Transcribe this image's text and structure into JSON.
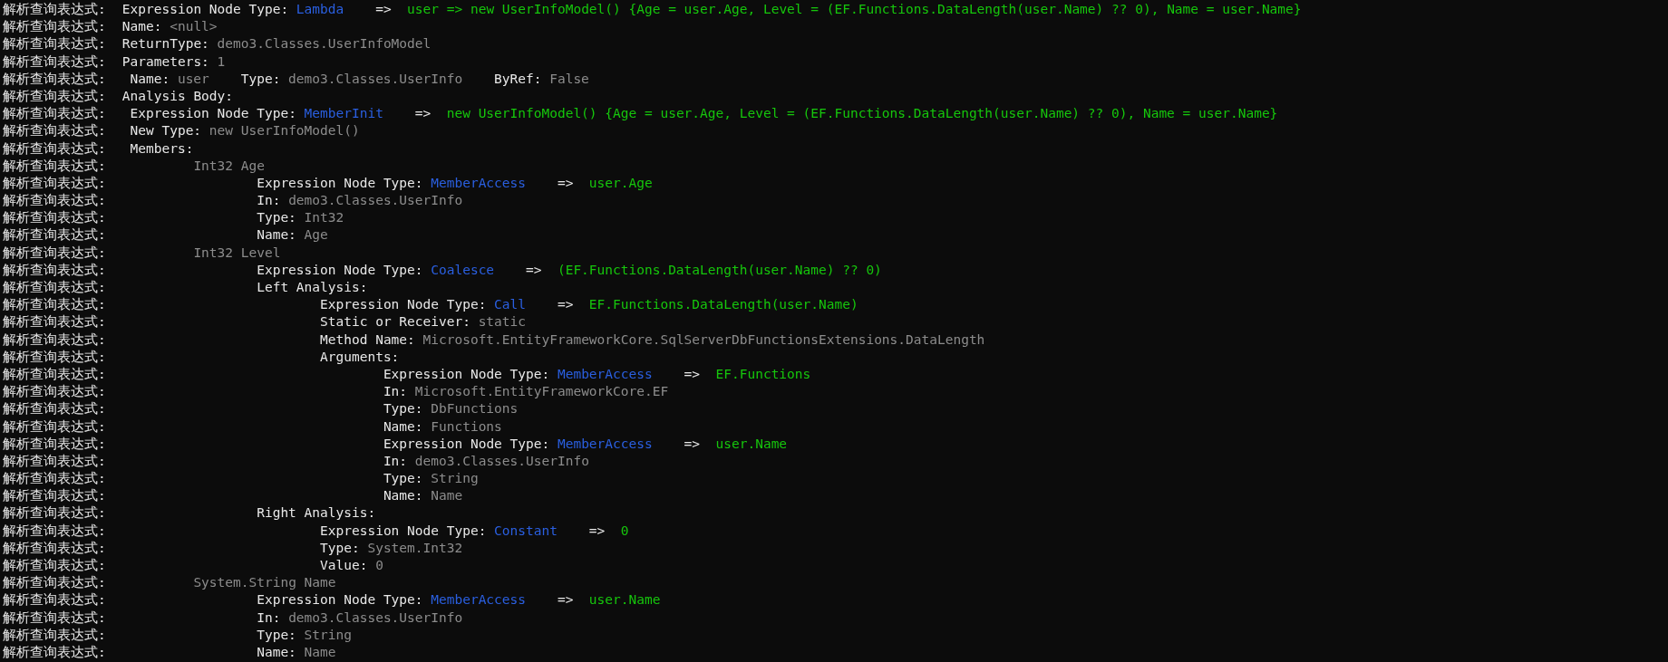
{
  "console": {
    "lines": [
      {
        "prefix": "解析查询表达式:",
        "parts": [
          {
            "kind": "label",
            "text": "Expression Node Type:"
          },
          {
            "kind": "node",
            "text": "Lambda"
          },
          {
            "kind": "arrow",
            "text": "=>"
          },
          {
            "kind": "expr",
            "text": "user => new UserInfoModel() {Age = user.Age, Level = (EF.Functions.DataLength(user.Name) ?? 0), Name = user.Name}"
          }
        ]
      },
      {
        "prefix": "解析查询表达式:",
        "parts": [
          {
            "kind": "label",
            "text": "Name:"
          },
          {
            "kind": "value",
            "text": "<null>"
          }
        ]
      },
      {
        "prefix": "解析查询表达式:",
        "parts": [
          {
            "kind": "label",
            "text": "ReturnType:"
          },
          {
            "kind": "value",
            "text": "demo3.Classes.UserInfoModel"
          }
        ]
      },
      {
        "prefix": "解析查询表达式:",
        "parts": [
          {
            "kind": "label",
            "text": "Parameters:"
          },
          {
            "kind": "value",
            "text": "1"
          }
        ],
        "children": [
          {
            "prefix": "解析查询表达式:",
            "parts": [
              {
                "kind": "label",
                "text": "Name:"
              },
              {
                "kind": "value",
                "text": "user"
              },
              {
                "kind": "label",
                "text": "Type:"
              },
              {
                "kind": "value",
                "text": "demo3.Classes.UserInfo"
              },
              {
                "kind": "label",
                "text": "ByRef:"
              },
              {
                "kind": "value",
                "text": "False"
              }
            ]
          }
        ]
      },
      {
        "prefix": "解析查询表达式:",
        "parts": [
          {
            "kind": "label",
            "text": "Analysis Body:"
          }
        ],
        "children": [
          {
            "prefix": "解析查询表达式:",
            "parts": [
              {
                "kind": "label",
                "text": "Expression Node Type:"
              },
              {
                "kind": "node",
                "text": "MemberInit"
              },
              {
                "kind": "arrow",
                "text": "=>"
              },
              {
                "kind": "expr",
                "text": "new UserInfoModel() {Age = user.Age, Level = (EF.Functions.DataLength(user.Name) ?? 0), Name = user.Name}"
              }
            ]
          },
          {
            "prefix": "解析查询表达式:",
            "parts": [
              {
                "kind": "label",
                "text": "New Type:"
              },
              {
                "kind": "value",
                "text": "new UserInfoModel()"
              }
            ]
          },
          {
            "prefix": "解析查询表达式:",
            "parts": [
              {
                "kind": "label",
                "text": "Members:"
              }
            ],
            "children": [
              {
                "prefix": "解析查询表达式:",
                "parts": [
                  {
                    "kind": "value",
                    "text": "Int32 Age"
                  }
                ],
                "children": [
                  {
                    "prefix": "解析查询表达式:",
                    "parts": [
                      {
                        "kind": "label",
                        "text": "Expression Node Type:"
                      },
                      {
                        "kind": "node",
                        "text": "MemberAccess"
                      },
                      {
                        "kind": "arrow",
                        "text": "=>"
                      },
                      {
                        "kind": "expr",
                        "text": "user.Age"
                      }
                    ]
                  },
                  {
                    "prefix": "解析查询表达式:",
                    "parts": [
                      {
                        "kind": "label",
                        "text": "In:"
                      },
                      {
                        "kind": "value",
                        "text": "demo3.Classes.UserInfo"
                      }
                    ]
                  },
                  {
                    "prefix": "解析查询表达式:",
                    "parts": [
                      {
                        "kind": "label",
                        "text": "Type:"
                      },
                      {
                        "kind": "value",
                        "text": "Int32"
                      }
                    ]
                  },
                  {
                    "prefix": "解析查询表达式:",
                    "parts": [
                      {
                        "kind": "label",
                        "text": "Name:"
                      },
                      {
                        "kind": "value",
                        "text": "Age"
                      }
                    ]
                  }
                ]
              },
              {
                "prefix": "解析查询表达式:",
                "parts": [
                  {
                    "kind": "value",
                    "text": "Int32 Level"
                  }
                ],
                "children": [
                  {
                    "prefix": "解析查询表达式:",
                    "parts": [
                      {
                        "kind": "label",
                        "text": "Expression Node Type:"
                      },
                      {
                        "kind": "node",
                        "text": "Coalesce"
                      },
                      {
                        "kind": "arrow",
                        "text": "=>"
                      },
                      {
                        "kind": "expr",
                        "text": "(EF.Functions.DataLength(user.Name) ?? 0)"
                      }
                    ]
                  },
                  {
                    "prefix": "解析查询表达式:",
                    "parts": [
                      {
                        "kind": "label",
                        "text": "Left Analysis:"
                      }
                    ],
                    "children": [
                      {
                        "prefix": "解析查询表达式:",
                        "parts": [
                          {
                            "kind": "label",
                            "text": "Expression Node Type:"
                          },
                          {
                            "kind": "node",
                            "text": "Call"
                          },
                          {
                            "kind": "arrow",
                            "text": "=>"
                          },
                          {
                            "kind": "expr",
                            "text": "EF.Functions.DataLength(user.Name)"
                          }
                        ]
                      },
                      {
                        "prefix": "解析查询表达式:",
                        "parts": [
                          {
                            "kind": "label",
                            "text": "Static or Receiver:"
                          },
                          {
                            "kind": "value",
                            "text": "static"
                          }
                        ]
                      },
                      {
                        "prefix": "解析查询表达式:",
                        "parts": [
                          {
                            "kind": "label",
                            "text": "Method Name:"
                          },
                          {
                            "kind": "value",
                            "text": "Microsoft.EntityFrameworkCore.SqlServerDbFunctionsExtensions.DataLength"
                          }
                        ]
                      },
                      {
                        "prefix": "解析查询表达式:",
                        "parts": [
                          {
                            "kind": "label",
                            "text": "Arguments:"
                          }
                        ],
                        "children": [
                          {
                            "prefix": "解析查询表达式:",
                            "parts": [
                              {
                                "kind": "label",
                                "text": "Expression Node Type:"
                              },
                              {
                                "kind": "node",
                                "text": "MemberAccess"
                              },
                              {
                                "kind": "arrow",
                                "text": "=>"
                              },
                              {
                                "kind": "expr",
                                "text": "EF.Functions"
                              }
                            ]
                          },
                          {
                            "prefix": "解析查询表达式:",
                            "parts": [
                              {
                                "kind": "label",
                                "text": "In:"
                              },
                              {
                                "kind": "value",
                                "text": "Microsoft.EntityFrameworkCore.EF"
                              }
                            ]
                          },
                          {
                            "prefix": "解析查询表达式:",
                            "parts": [
                              {
                                "kind": "label",
                                "text": "Type:"
                              },
                              {
                                "kind": "value",
                                "text": "DbFunctions"
                              }
                            ]
                          },
                          {
                            "prefix": "解析查询表达式:",
                            "parts": [
                              {
                                "kind": "label",
                                "text": "Name:"
                              },
                              {
                                "kind": "value",
                                "text": "Functions"
                              }
                            ]
                          },
                          {
                            "prefix": "解析查询表达式:",
                            "parts": [
                              {
                                "kind": "label",
                                "text": "Expression Node Type:"
                              },
                              {
                                "kind": "node",
                                "text": "MemberAccess"
                              },
                              {
                                "kind": "arrow",
                                "text": "=>"
                              },
                              {
                                "kind": "expr",
                                "text": "user.Name"
                              }
                            ]
                          },
                          {
                            "prefix": "解析查询表达式:",
                            "parts": [
                              {
                                "kind": "label",
                                "text": "In:"
                              },
                              {
                                "kind": "value",
                                "text": "demo3.Classes.UserInfo"
                              }
                            ]
                          },
                          {
                            "prefix": "解析查询表达式:",
                            "parts": [
                              {
                                "kind": "label",
                                "text": "Type:"
                              },
                              {
                                "kind": "value",
                                "text": "String"
                              }
                            ]
                          },
                          {
                            "prefix": "解析查询表达式:",
                            "parts": [
                              {
                                "kind": "label",
                                "text": "Name:"
                              },
                              {
                                "kind": "value",
                                "text": "Name"
                              }
                            ]
                          }
                        ]
                      }
                    ]
                  },
                  {
                    "prefix": "解析查询表达式:",
                    "parts": [
                      {
                        "kind": "label",
                        "text": "Right Analysis:"
                      }
                    ],
                    "children": [
                      {
                        "prefix": "解析查询表达式:",
                        "parts": [
                          {
                            "kind": "label",
                            "text": "Expression Node Type:"
                          },
                          {
                            "kind": "node",
                            "text": "Constant"
                          },
                          {
                            "kind": "arrow",
                            "text": "=>"
                          },
                          {
                            "kind": "expr",
                            "text": "0"
                          }
                        ]
                      },
                      {
                        "prefix": "解析查询表达式:",
                        "parts": [
                          {
                            "kind": "label",
                            "text": "Type:"
                          },
                          {
                            "kind": "value",
                            "text": "System.Int32"
                          }
                        ]
                      },
                      {
                        "prefix": "解析查询表达式:",
                        "parts": [
                          {
                            "kind": "label",
                            "text": "Value:"
                          },
                          {
                            "kind": "value",
                            "text": "0"
                          }
                        ]
                      }
                    ]
                  }
                ]
              },
              {
                "prefix": "解析查询表达式:",
                "parts": [
                  {
                    "kind": "value",
                    "text": "System.String Name"
                  }
                ],
                "children": [
                  {
                    "prefix": "解析查询表达式:",
                    "parts": [
                      {
                        "kind": "label",
                        "text": "Expression Node Type:"
                      },
                      {
                        "kind": "node",
                        "text": "MemberAccess"
                      },
                      {
                        "kind": "arrow",
                        "text": "=>"
                      },
                      {
                        "kind": "expr",
                        "text": "user.Name"
                      }
                    ]
                  },
                  {
                    "prefix": "解析查询表达式:",
                    "parts": [
                      {
                        "kind": "label",
                        "text": "In:"
                      },
                      {
                        "kind": "value",
                        "text": "demo3.Classes.UserInfo"
                      }
                    ]
                  },
                  {
                    "prefix": "解析查询表达式:",
                    "parts": [
                      {
                        "kind": "label",
                        "text": "Type:"
                      },
                      {
                        "kind": "value",
                        "text": "String"
                      }
                    ]
                  },
                  {
                    "prefix": "解析查询表达式:",
                    "parts": [
                      {
                        "kind": "label",
                        "text": "Name:"
                      },
                      {
                        "kind": "value",
                        "text": "Name"
                      }
                    ]
                  }
                ]
              }
            ]
          }
        ]
      }
    ]
  }
}
